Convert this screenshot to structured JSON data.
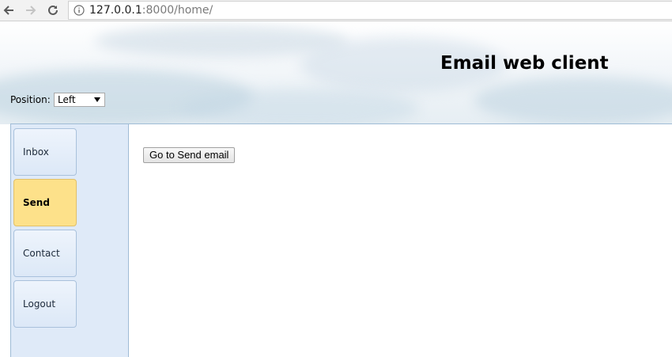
{
  "browser": {
    "url_host": "127.0.0.1",
    "url_rest": ":8000/home/",
    "icons": [
      "back-arrow-icon",
      "forward-arrow-icon",
      "reload-icon",
      "info-icon"
    ]
  },
  "header": {
    "title": "Email web client",
    "position_label": "Position:",
    "position_value": "Left"
  },
  "sidebar": {
    "items": [
      {
        "label": "Inbox",
        "active": false
      },
      {
        "label": "Send",
        "active": true
      },
      {
        "label": "Contact",
        "active": false
      },
      {
        "label": "Logout",
        "active": false
      }
    ]
  },
  "main": {
    "go_send_label": "Go to Send email"
  },
  "colors": {
    "active_item": "#fde18a",
    "sidebar_bg": "#dfeaf8",
    "border": "#9fbcd6"
  }
}
